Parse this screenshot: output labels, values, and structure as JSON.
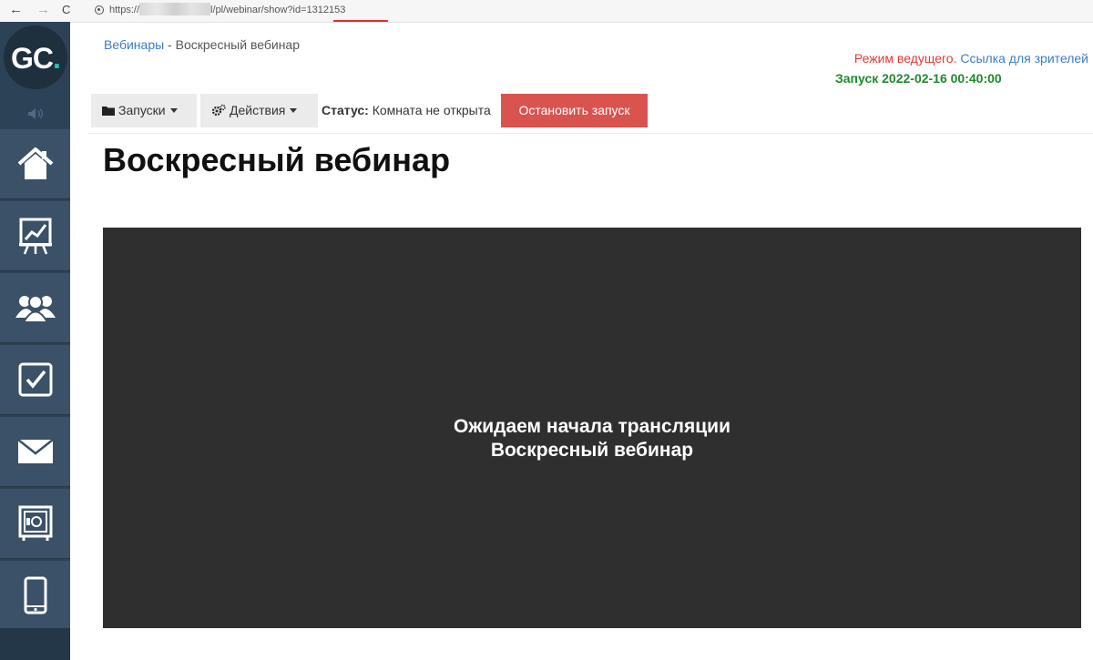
{
  "browser": {
    "url_prefix": "https://",
    "url_suffix": "l/pl/webinar/show?id=1312153",
    "back_icon": "←",
    "forward_icon": "→",
    "reload_icon": "C"
  },
  "sidebar": {
    "logo_main": "GC",
    "logo_dot": ".",
    "accent": "#1ec9b0",
    "items": [
      {
        "icon": "home-icon"
      },
      {
        "icon": "chart-icon"
      },
      {
        "icon": "users-icon"
      },
      {
        "icon": "checkbox-icon"
      },
      {
        "icon": "mail-icon"
      },
      {
        "icon": "safe-icon"
      },
      {
        "icon": "mobile-icon"
      }
    ]
  },
  "breadcrumb": {
    "parent": "Вебинары",
    "separator": " - ",
    "current": "Воскресный вебинар"
  },
  "header": {
    "mode_label": "Режим ведущего.",
    "viewer_link": "Ссылка для зрителей",
    "launch_label": "Запуск 2022-02-16 00:40:00"
  },
  "toolbar": {
    "launches_label": "Запуски",
    "actions_label": "Действия",
    "status_label": "Статус:",
    "status_value": "Комната не открыта",
    "stop_label": "Остановить запуск",
    "stop_color": "#d9534f"
  },
  "page": {
    "title": "Воскресный вебинар"
  },
  "player": {
    "line1": "Ожидаем начала трансляции",
    "line2": "Воскресный вебинар"
  }
}
